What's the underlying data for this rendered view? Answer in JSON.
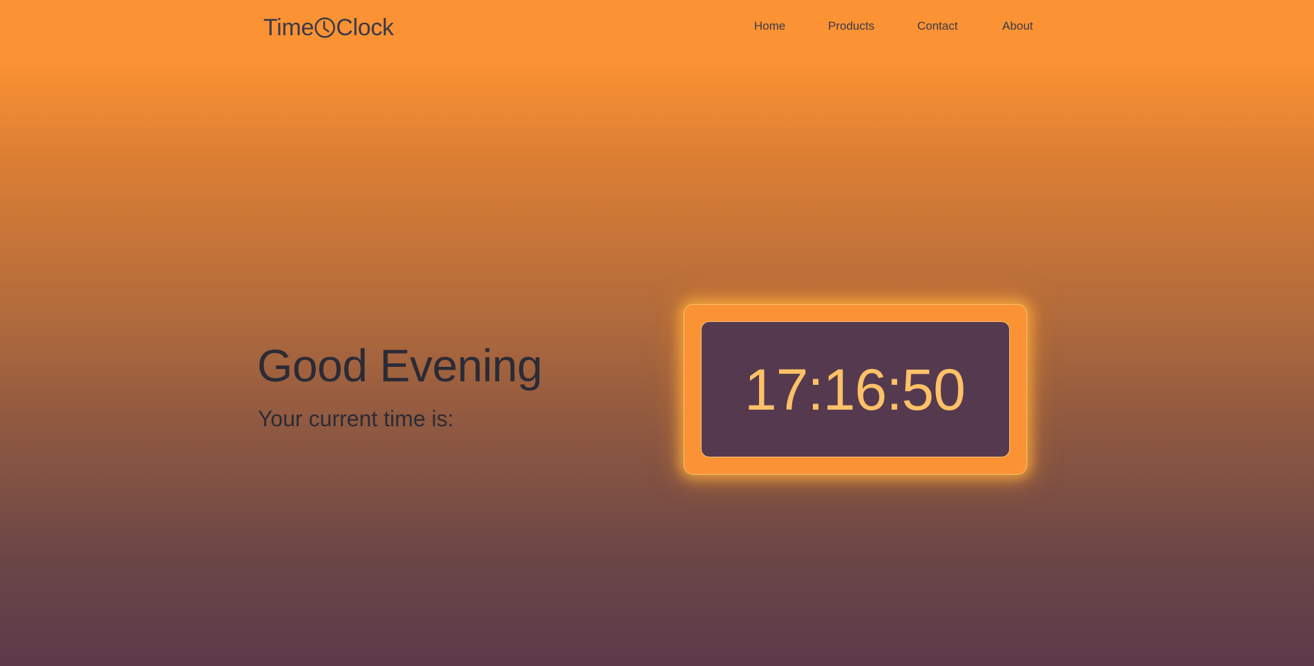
{
  "header": {
    "logo_left": "Time",
    "logo_right": "Clock",
    "logo_icon": "clock-icon"
  },
  "nav": {
    "items": [
      {
        "label": "Home"
      },
      {
        "label": "Products"
      },
      {
        "label": "Contact"
      },
      {
        "label": "About"
      }
    ]
  },
  "main": {
    "greeting": "Good Evening",
    "subtitle": "Your current time is:"
  },
  "clock": {
    "time": "17:16:50"
  },
  "colors": {
    "background_top": "#fb9233",
    "background_bottom": "#5c3a4a",
    "clock_frame": "#fb9233",
    "clock_screen": "#553a4f",
    "clock_digits": "#ffc168",
    "text": "#2b2b36"
  }
}
